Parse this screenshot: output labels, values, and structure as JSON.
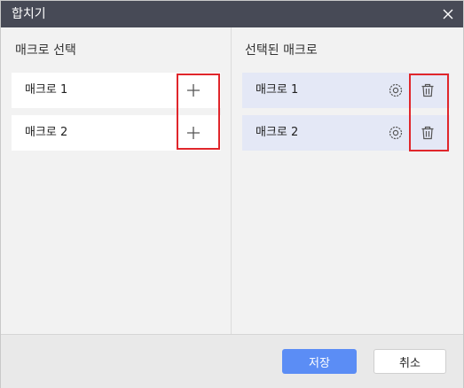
{
  "dialog": {
    "title": "합치기",
    "close_icon": "close-icon"
  },
  "left_panel": {
    "title": "매크로 선택",
    "items": [
      {
        "label": "매크로 1",
        "icon": "plus-icon"
      },
      {
        "label": "매크로 2",
        "icon": "plus-icon"
      }
    ]
  },
  "right_panel": {
    "title": "선택된 매크로",
    "items": [
      {
        "label": "매크로 1",
        "icons": [
          "gear-icon",
          "trash-icon"
        ]
      },
      {
        "label": "매크로 2",
        "icons": [
          "gear-icon",
          "trash-icon"
        ]
      }
    ]
  },
  "footer": {
    "save_label": "저장",
    "cancel_label": "취소"
  },
  "colors": {
    "titlebar": "#474a56",
    "primary_button": "#5b8df5",
    "selected_row": "#e4e8f6",
    "highlight": "#e0262b"
  }
}
